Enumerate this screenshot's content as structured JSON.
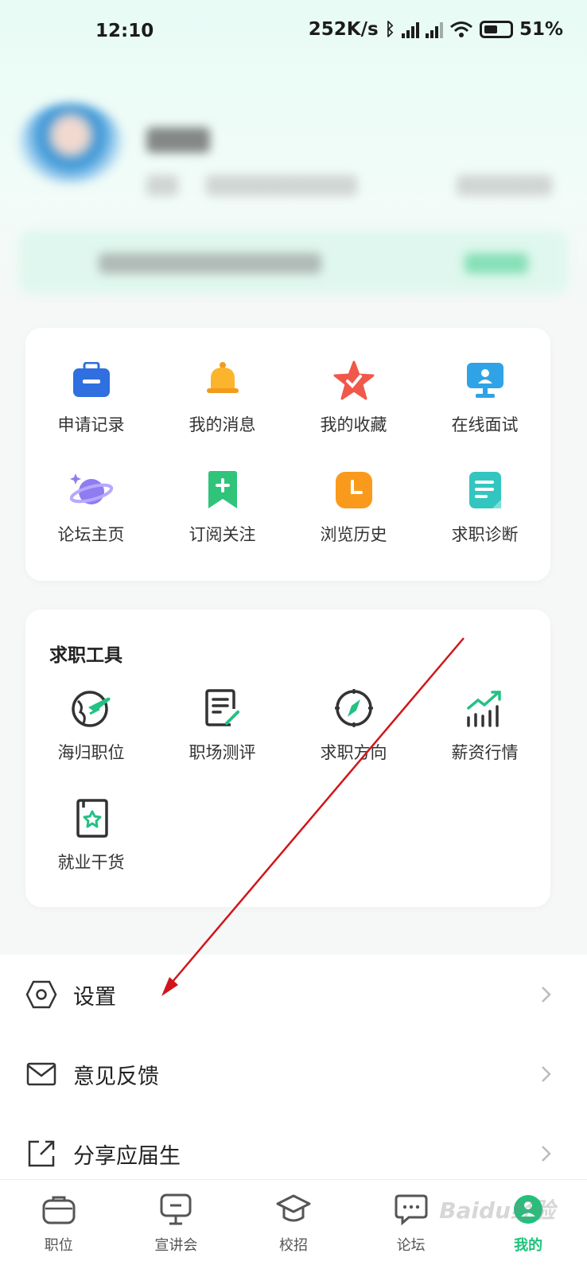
{
  "status_bar": {
    "time": "12:10",
    "speed": "252K/s",
    "battery": "51%"
  },
  "quick_menu": {
    "items": [
      {
        "label": "申请记录",
        "icon": "briefcase-icon"
      },
      {
        "label": "我的消息",
        "icon": "bell-icon"
      },
      {
        "label": "我的收藏",
        "icon": "star-icon"
      },
      {
        "label": "在线面试",
        "icon": "monitor-icon"
      },
      {
        "label": "论坛主页",
        "icon": "planet-icon"
      },
      {
        "label": "订阅关注",
        "icon": "bookmark-icon"
      },
      {
        "label": "浏览历史",
        "icon": "clock-icon"
      },
      {
        "label": "求职诊断",
        "icon": "document-icon"
      }
    ]
  },
  "tools": {
    "title": "求职工具",
    "items": [
      {
        "label": "海归职位",
        "icon": "globe-plane-icon"
      },
      {
        "label": "职场测评",
        "icon": "clipboard-edit-icon"
      },
      {
        "label": "求职方向",
        "icon": "compass-icon"
      },
      {
        "label": "薪资行情",
        "icon": "trend-chart-icon"
      },
      {
        "label": "就业干货",
        "icon": "book-star-icon"
      }
    ]
  },
  "menu": {
    "settings": "设置",
    "feedback": "意见反馈",
    "share": "分享应届生"
  },
  "tabbar": {
    "tabs": [
      {
        "label": "职位",
        "icon": "bag-icon"
      },
      {
        "label": "宣讲会",
        "icon": "podium-icon"
      },
      {
        "label": "校招",
        "icon": "graduation-cap-icon"
      },
      {
        "label": "论坛",
        "icon": "chat-icon"
      },
      {
        "label": "我的",
        "icon": "profile-icon"
      }
    ]
  },
  "watermark": "Baidu经验",
  "colors": {
    "accent": "#1ec27a",
    "arrow": "#d0161b"
  }
}
